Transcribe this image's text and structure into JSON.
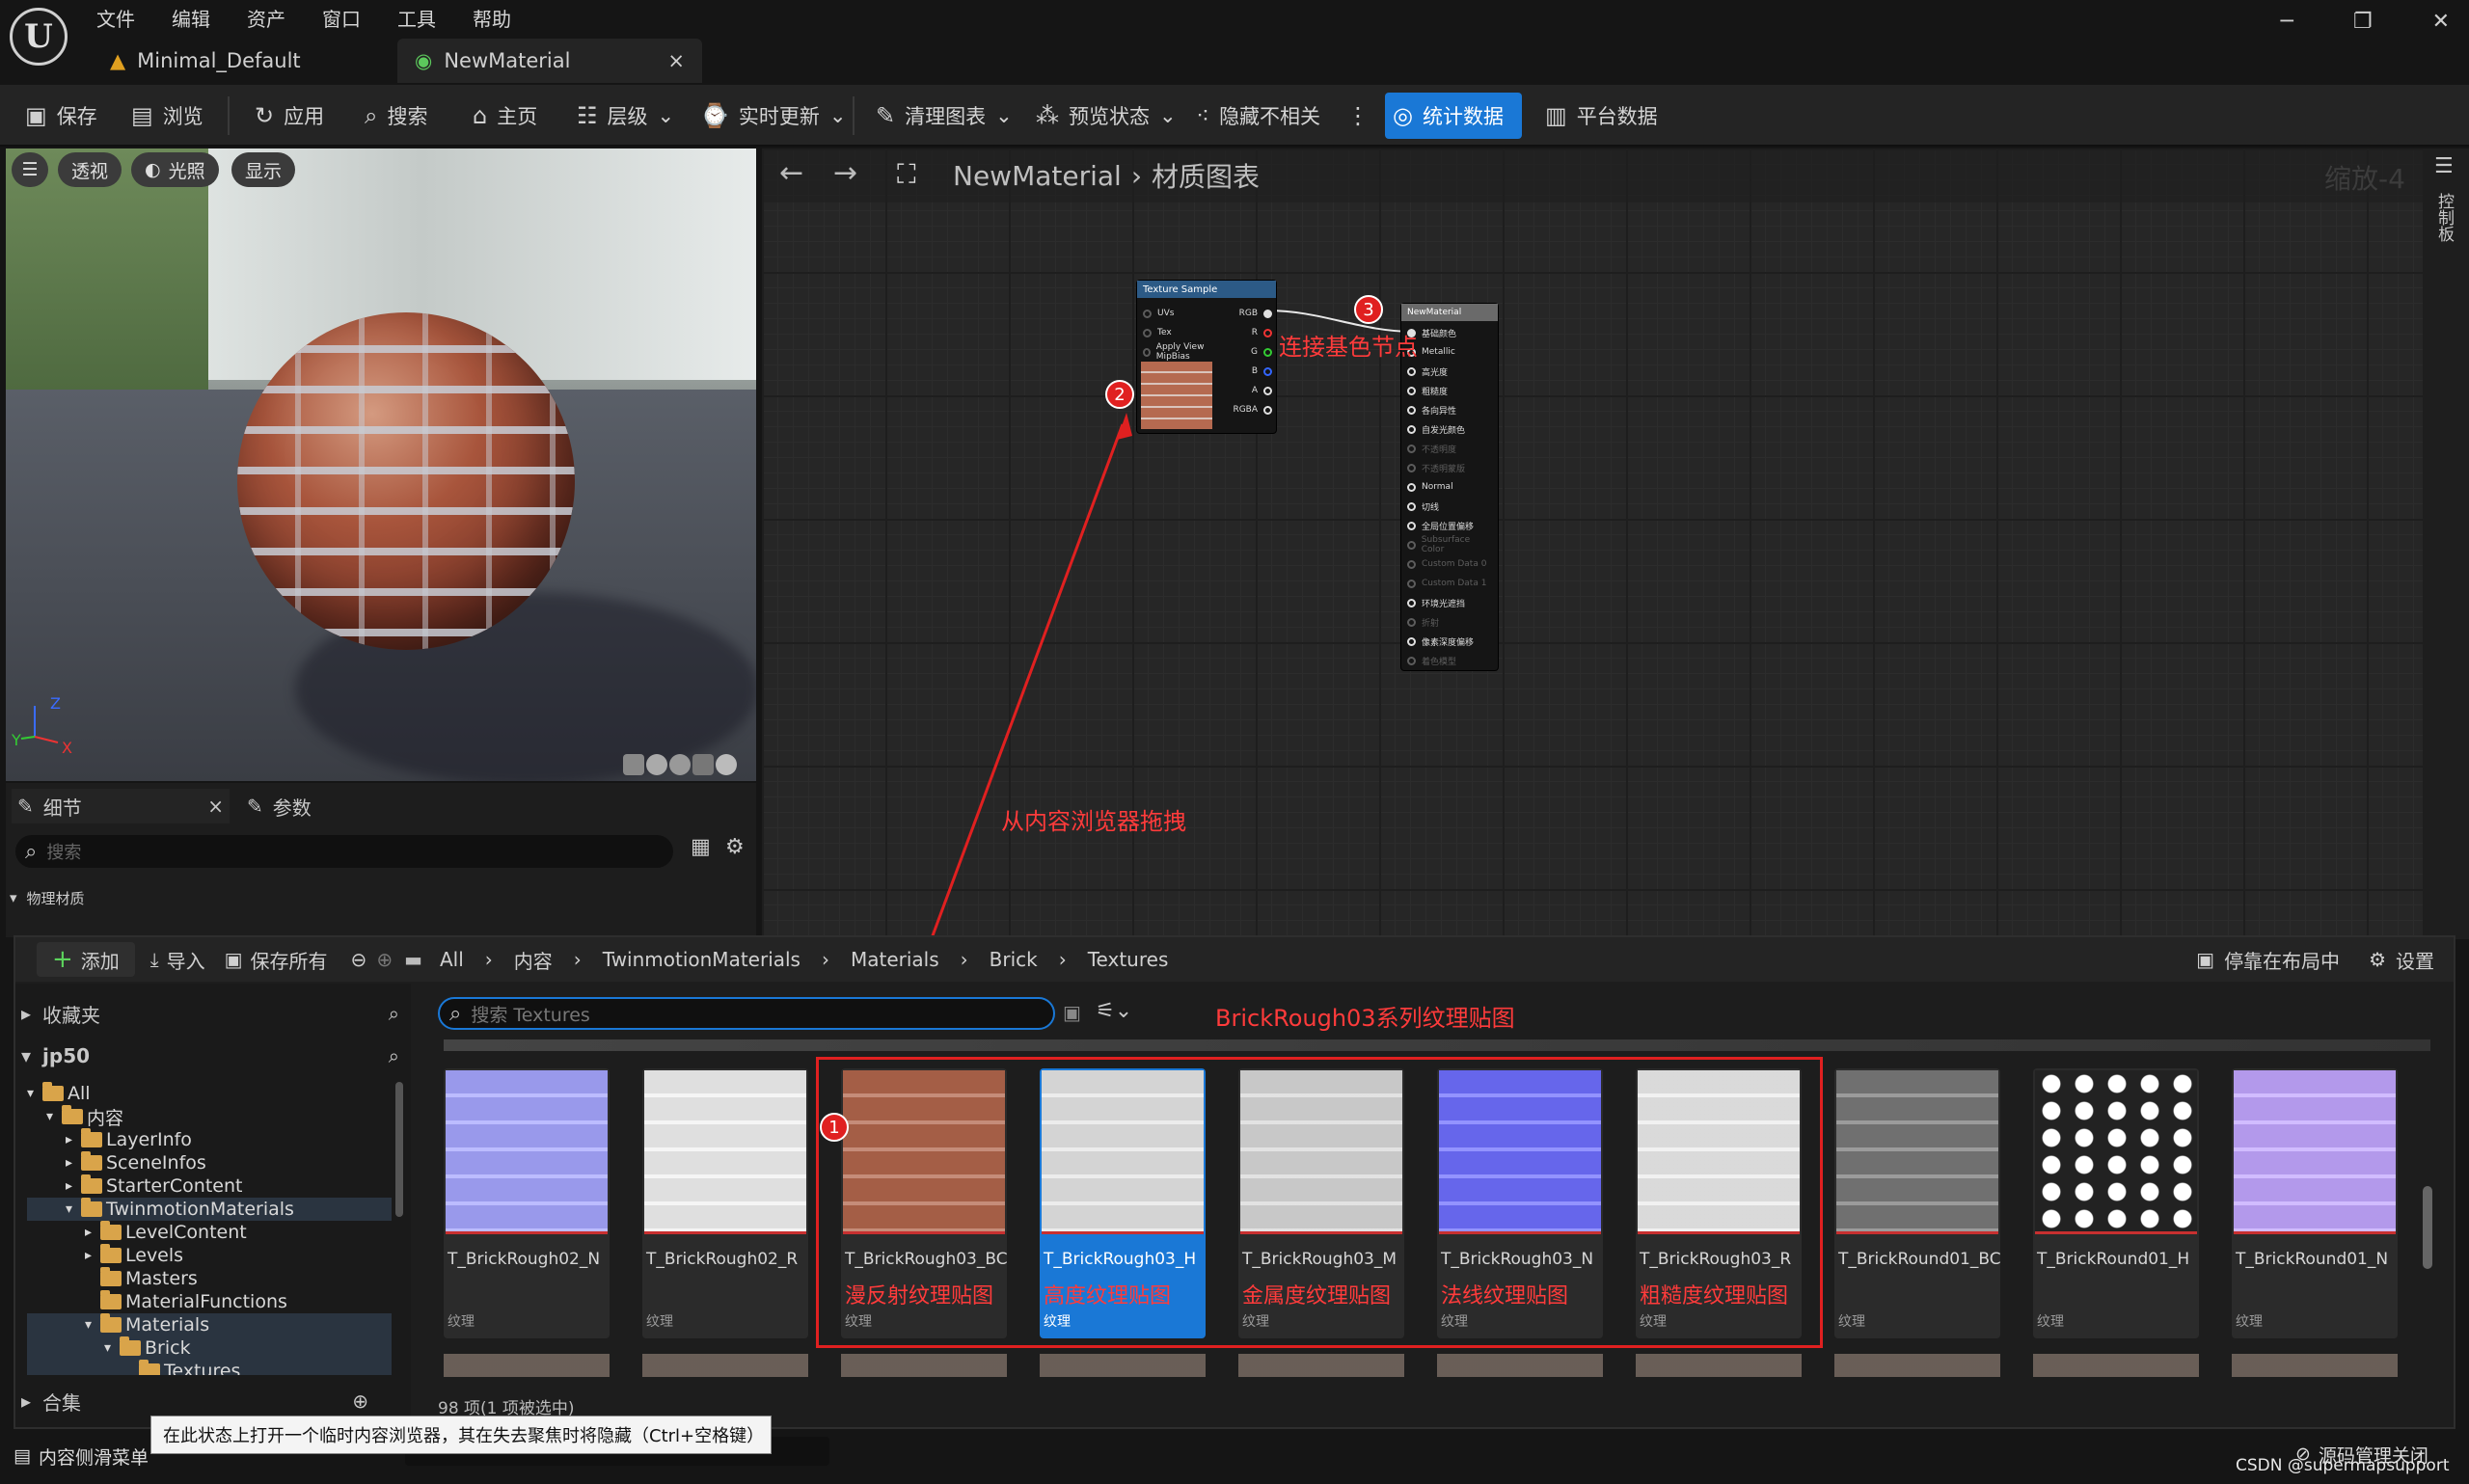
{
  "menu": [
    "文件",
    "编辑",
    "资产",
    "窗口",
    "工具",
    "帮助"
  ],
  "tabs": [
    {
      "label": "Minimal_Default"
    },
    {
      "label": "NewMaterial",
      "close": "×"
    }
  ],
  "toolbar": {
    "save": "保存",
    "browse": "浏览",
    "apply": "应用",
    "search": "搜索",
    "home": "主页",
    "hierarchy": "层级",
    "live_update": "实时更新",
    "clean_graph": "清理图表",
    "preview_state": "预览状态",
    "hide_unrelated": "隐藏不相关",
    "stats": "统计数据",
    "platform": "平台数据"
  },
  "viewport": {
    "perspective": "透视",
    "lit": "光照",
    "show": "显示",
    "axis_x": "X",
    "axis_y": "Y",
    "axis_z": "Z"
  },
  "details": {
    "tab_details": "细节",
    "tab_params": "参数",
    "search_placeholder": "搜索",
    "category": "物理材质"
  },
  "graph": {
    "path_root": "NewMaterial",
    "path_sep": "›",
    "path_leaf": "材质图表",
    "zoom": "缩放-4",
    "right_label": "控制板"
  },
  "node_texture": {
    "title": "Texture Sample",
    "inputs": [
      "UVs",
      "Tex",
      "Apply View MipBias"
    ],
    "outputs": [
      "RGB",
      "R",
      "G",
      "B",
      "A",
      "RGBA"
    ]
  },
  "node_material": {
    "title": "NewMaterial",
    "pins": [
      {
        "label": "基础颜色",
        "on": true
      },
      {
        "label": "Metallic",
        "on": true
      },
      {
        "label": "高光度",
        "on": true
      },
      {
        "label": "粗糙度",
        "on": true
      },
      {
        "label": "各向异性",
        "on": true
      },
      {
        "label": "自发光颜色",
        "on": true
      },
      {
        "label": "不透明度",
        "on": false
      },
      {
        "label": "不透明蒙版",
        "on": false
      },
      {
        "label": "Normal",
        "on": true
      },
      {
        "label": "切线",
        "on": true
      },
      {
        "label": "全局位置偏移",
        "on": true
      },
      {
        "label": "Subsurface Color",
        "on": false
      },
      {
        "label": "Custom Data 0",
        "on": false
      },
      {
        "label": "Custom Data 1",
        "on": false
      },
      {
        "label": "环境光遮挡",
        "on": true
      },
      {
        "label": "折射",
        "on": false
      },
      {
        "label": "像素深度偏移",
        "on": true
      },
      {
        "label": "着色模型",
        "on": false
      }
    ]
  },
  "annotations": {
    "badge1": "1",
    "badge2": "2",
    "badge3": "3",
    "connect_base": "连接基色节点",
    "drag_from_cb": "从内容浏览器拖拽",
    "series": "BrickRough03系列纹理贴图"
  },
  "content_browser": {
    "add": "添加",
    "import": "导入",
    "save_all": "保存所有",
    "breadcrumb": [
      "All",
      "内容",
      "TwinmotionMaterials",
      "Materials",
      "Brick",
      "Textures"
    ],
    "dock": "停靠在布局中",
    "settings": "设置",
    "favorites": "收藏夹",
    "project": "jp50",
    "collections": "合集",
    "search_placeholder": "搜索 Textures",
    "item_count": "98 项(1 项被选中)",
    "tree": [
      {
        "label": "All",
        "depth": 0
      },
      {
        "label": "内容",
        "depth": 1
      },
      {
        "label": "LayerInfo",
        "depth": 2
      },
      {
        "label": "SceneInfos",
        "depth": 2
      },
      {
        "label": "StarterContent",
        "depth": 2
      },
      {
        "label": "TwinmotionMaterials",
        "depth": 2
      },
      {
        "label": "LevelContent",
        "depth": 3
      },
      {
        "label": "Levels",
        "depth": 3
      },
      {
        "label": "Masters",
        "depth": 3
      },
      {
        "label": "MaterialFunctions",
        "depth": 3
      },
      {
        "label": "Materials",
        "depth": 3
      },
      {
        "label": "Brick",
        "depth": 4
      },
      {
        "label": "Textures",
        "depth": 5
      }
    ],
    "assets": [
      {
        "name": "T_BrickRough02_N",
        "type": "纹理",
        "sub": "",
        "color": "#a6a6ff"
      },
      {
        "name": "T_BrickRough02_R",
        "type": "纹理",
        "sub": "",
        "color": "#f2f2f2"
      },
      {
        "name": "T_BrickRough03_BC",
        "type": "纹理",
        "sub": "漫反射纹理贴图",
        "color": "#b2664c"
      },
      {
        "name": "T_BrickRough03_H",
        "type": "纹理",
        "sub": "高度纹理贴图",
        "color": "#e6e6e6"
      },
      {
        "name": "T_BrickRough03_M",
        "type": "纹理",
        "sub": "金属度纹理贴图",
        "color": "#d9d9d9"
      },
      {
        "name": "T_BrickRough03_N",
        "type": "纹理",
        "sub": "法线纹理贴图",
        "color": "#6f6fff"
      },
      {
        "name": "T_BrickRough03_R",
        "type": "纹理",
        "sub": "粗糙度纹理贴图",
        "color": "#ececec"
      },
      {
        "name": "T_BrickRound01_BC",
        "type": "纹理",
        "sub": "",
        "color": "#7a7a7a"
      },
      {
        "name": "T_BrickRound01_H",
        "type": "纹理",
        "sub": "",
        "color": "#e0e0e0"
      },
      {
        "name": "T_BrickRound01_N",
        "type": "纹理",
        "sub": "",
        "color": "#c2a6ff"
      }
    ]
  },
  "status": {
    "drawer": "内容侧滑菜单",
    "tooltip": "在此状态上打开一个临时内容浏览器，其在失去聚焦时将隐藏（Ctrl+空格键）",
    "source_control": "源码管理关闭",
    "watermark": "CSDN @supermapsupport"
  }
}
